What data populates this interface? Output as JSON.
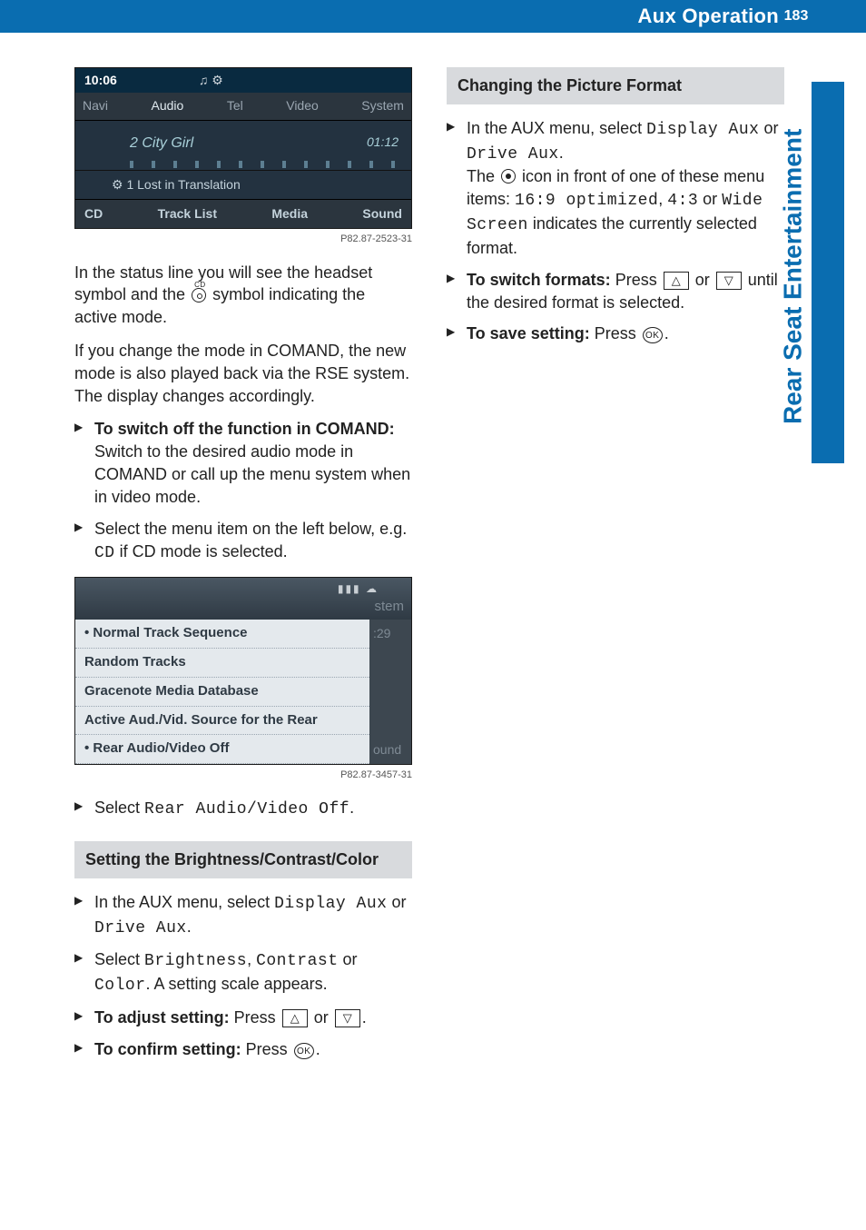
{
  "header": {
    "title": "Aux Operation",
    "page": "183"
  },
  "side_tab": "Rear Seat Entertainment",
  "shot1": {
    "clock": "10:06",
    "icons": "♫ ⚙",
    "tabs": [
      "Navi",
      "Audio",
      "Tel",
      "Video",
      "System"
    ],
    "song": "2 City Girl",
    "runtime": "01:12",
    "row2": "⚙ 1 Lost in Translation",
    "bottom": [
      "CD",
      "Track List",
      "Media",
      "Sound"
    ],
    "id": "P82.87-2523-31"
  },
  "para1": "In the status line you will see the headset symbol and the ",
  "para1b": " symbol indicating the active mode.",
  "para2": "If you change the mode in COMAND, the new mode is also played back via the RSE system. The display changes accordingly.",
  "list1": {
    "a_bold": "To switch off the function in COMAND:",
    "a_rest": " Switch to the desired audio mode in COMAND or call up the menu system when in video mode.",
    "b_pre": "Select the menu item on the left below, e.g. ",
    "b_mono": "CD",
    "b_post": " if CD mode is selected."
  },
  "shot2": {
    "stem": "stem",
    "items": [
      {
        "text": "Normal Track Sequence",
        "dot": true
      },
      {
        "text": "Random Tracks",
        "dot": false
      },
      {
        "text": "Gracenote Media Database",
        "dot": false
      },
      {
        "text": "Active Aud./Vid. Source for the Rear",
        "dot": false
      },
      {
        "text": "Rear Audio/Video Off",
        "dot": true
      }
    ],
    "right_top": ":29",
    "right_bot": "ound",
    "id": "P82.87-3457-31"
  },
  "list2": {
    "a_pre": "Select ",
    "a_mono": "Rear Audio/Video Off",
    "a_post": "."
  },
  "section1": "Setting the Brightness/Contrast/Color",
  "sec1_list": {
    "a_pre": "In the AUX menu, select ",
    "a_m1": "Display Aux",
    "a_mid": " or ",
    "a_m2": "Drive Aux",
    "a_post": ".",
    "b_pre": "Select ",
    "b_m1": "Brightness",
    "b_c1": ", ",
    "b_m2": "Contrast",
    "b_c2": " or ",
    "b_m3": "Color",
    "b_post": ". A setting scale appears.",
    "c_bold": "To adjust setting:",
    "c_rest_pre": " Press ",
    "c_rest_mid": " or ",
    "c_rest_post": ".",
    "d_bold": "To confirm setting:",
    "d_rest_pre": " Press ",
    "d_rest_post": "."
  },
  "section2": "Changing the Picture Format",
  "sec2_list": {
    "a_pre": "In the AUX menu, select ",
    "a_m1": "Display Aux",
    "a_mid": " or ",
    "a_m2": "Drive Aux",
    "a_post": ".",
    "a_line2_pre": "The ",
    "a_line2_mid": " icon in front of one of these menu items: ",
    "a_m3": "16:9 optimized",
    "a_c1": ", ",
    "a_m4": "4:3",
    "a_c2": " or ",
    "a_m5": "Wide Screen",
    "a_line2_post": " indicates the currently selected format.",
    "b_bold": "To switch formats:",
    "b_pre": " Press ",
    "b_mid": " or ",
    "b_post": " until the desired format is selected.",
    "c_bold": "To save setting:",
    "c_pre": " Press ",
    "c_post": "."
  },
  "key_up": "△",
  "key_down": "▽",
  "ok": "OK"
}
